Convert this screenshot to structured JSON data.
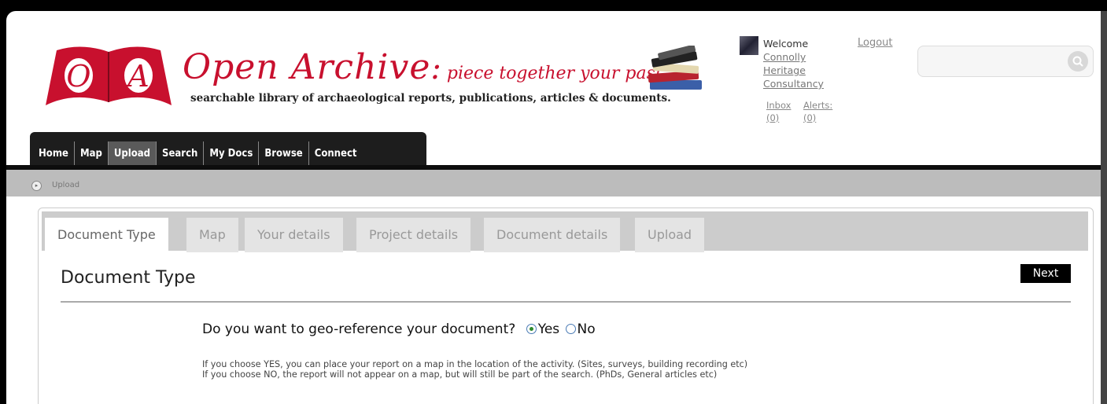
{
  "brand": {
    "logo_letters": [
      "O",
      "A"
    ],
    "title_word1": "Open",
    "title_word2": "Archive",
    "colon": ":",
    "tagline": "piece together your past",
    "subtitle": "searchable library of archaeological reports, publications, articles & documents.",
    "color": "#c8102e"
  },
  "user": {
    "welcome": "Welcome",
    "name": "Connolly Heritage Consultancy",
    "logout": "Logout",
    "inbox": "Inbox",
    "inbox_count": "(0)",
    "alerts": "Alerts:",
    "alerts_count": "(0)"
  },
  "search": {
    "placeholder": "",
    "icon": "search-icon"
  },
  "nav": {
    "items": [
      "Home",
      "Map",
      "Upload",
      "Search",
      "My Docs",
      "Browse",
      "Connect"
    ],
    "active": "Upload"
  },
  "breadcrumb": {
    "current": "Upload"
  },
  "tabs": [
    "Document Type",
    "Map",
    "Your details",
    "Project details",
    "Document details",
    "Upload"
  ],
  "active_tab": "Document Type",
  "page": {
    "title": "Document Type",
    "next_label": "Next",
    "question": "Do you want to geo-reference your document?",
    "option_yes": "Yes",
    "option_no": "No",
    "selected": "Yes",
    "help_yes": "If you choose YES, you can place your report on a map in the location of the activity. (Sites, surveys, building recording etc)",
    "help_no": "If you choose NO, the report will not appear on a map, but will still be part of the search. (PhDs, General articles etc)"
  }
}
